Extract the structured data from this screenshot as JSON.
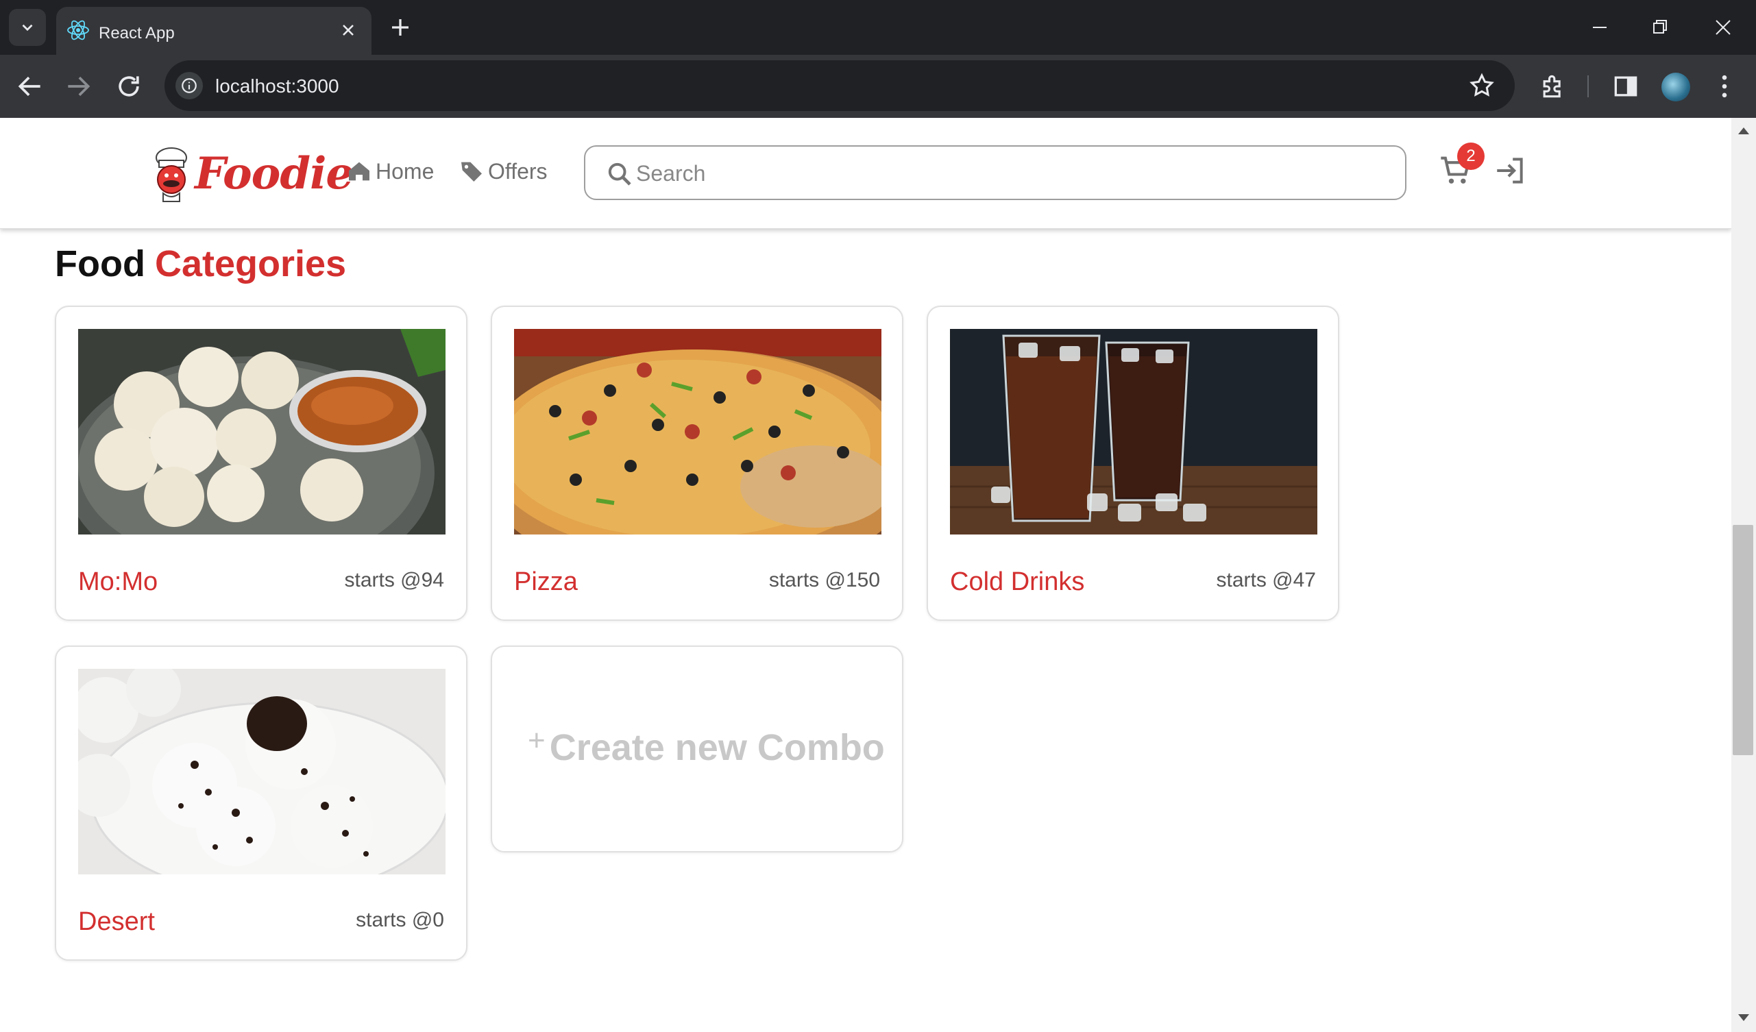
{
  "browser": {
    "tab_title": "React App",
    "url": "localhost:3000"
  },
  "header": {
    "logo_text": "Foodie",
    "nav": [
      {
        "label": "Home",
        "icon": "home-icon"
      },
      {
        "label": "Offers",
        "icon": "tag-icon"
      }
    ],
    "search_placeholder": "Search",
    "search_value": "",
    "cart_count": "2"
  },
  "section": {
    "title_main": "Food",
    "title_accent": "Categories"
  },
  "categories": [
    {
      "name": "Mo:Mo",
      "price": "starts @94",
      "image": "momo-image"
    },
    {
      "name": "Pizza",
      "price": "starts @150",
      "image": "pizza-image"
    },
    {
      "name": "Cold Drinks",
      "price": "starts @47",
      "image": "cold-drinks-image"
    },
    {
      "name": "Desert",
      "price": "starts @0",
      "image": "desert-image"
    }
  ],
  "combo": {
    "plus": "+",
    "label": "Create new Combo"
  },
  "colors": {
    "accent": "#d32f2f",
    "badge": "#e53935",
    "muted_text": "#707070"
  }
}
